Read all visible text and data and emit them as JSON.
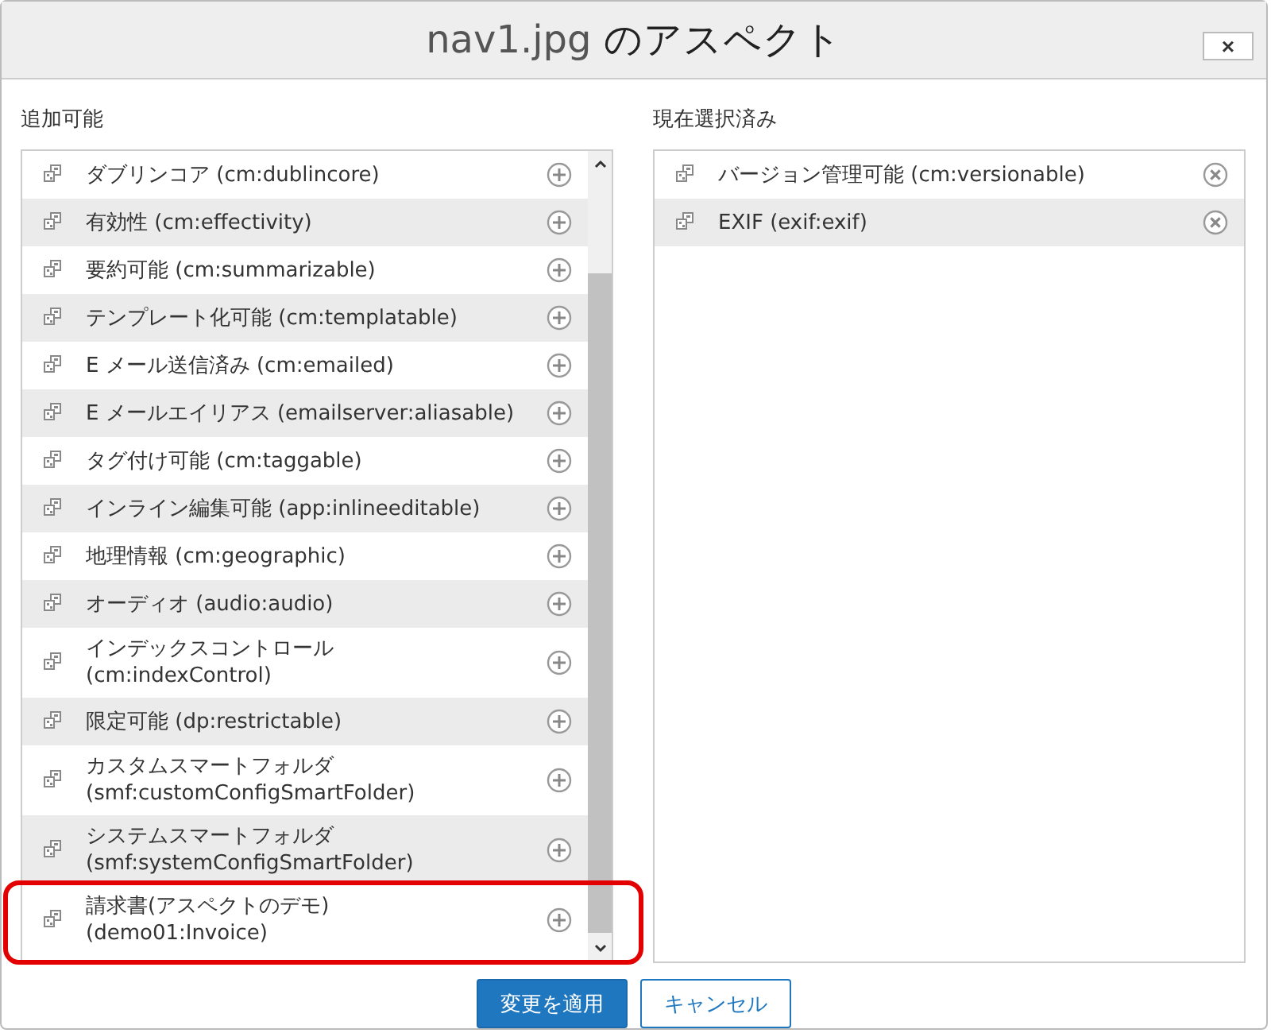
{
  "dialog": {
    "title_file": "nav1.jpg",
    "title_suffix": "のアスペクト",
    "close": "×"
  },
  "available": {
    "heading": "追加可能",
    "items": [
      {
        "label": "ダブリンコア (cm:dublincore)",
        "highlighted": false
      },
      {
        "label": "有効性 (cm:effectivity)",
        "highlighted": false
      },
      {
        "label": "要約可能 (cm:summarizable)",
        "highlighted": false
      },
      {
        "label": "テンプレート化可能 (cm:templatable)",
        "highlighted": false
      },
      {
        "label": "E メール送信済み (cm:emailed)",
        "highlighted": false
      },
      {
        "label": "E メールエイリアス (emailserver:aliasable)",
        "highlighted": false
      },
      {
        "label": "タグ付け可能 (cm:taggable)",
        "highlighted": false
      },
      {
        "label": "インライン編集可能 (app:inlineeditable)",
        "highlighted": false
      },
      {
        "label": "地理情報 (cm:geographic)",
        "highlighted": false
      },
      {
        "label": "オーディオ (audio:audio)",
        "highlighted": false
      },
      {
        "label": "インデックスコントロール\n(cm:indexControl)",
        "highlighted": false
      },
      {
        "label": "限定可能 (dp:restrictable)",
        "highlighted": false
      },
      {
        "label": "カスタムスマートフォルダ\n(smf:customConfigSmartFolder)",
        "highlighted": false
      },
      {
        "label": "システムスマートフォルダ\n(smf:systemConfigSmartFolder)",
        "highlighted": false
      },
      {
        "label": "請求書(アスペクトのデモ)\n(demo01:Invoice)",
        "highlighted": true
      }
    ]
  },
  "selected": {
    "heading": "現在選択済み",
    "items": [
      {
        "label": "バージョン管理可能 (cm:versionable)"
      },
      {
        "label": "EXIF (exif:exif)"
      }
    ]
  },
  "buttons": [
    {
      "label": "変更を適用",
      "kind": "primary"
    },
    {
      "label": "キャンセル",
      "kind": "secondary"
    }
  ]
}
